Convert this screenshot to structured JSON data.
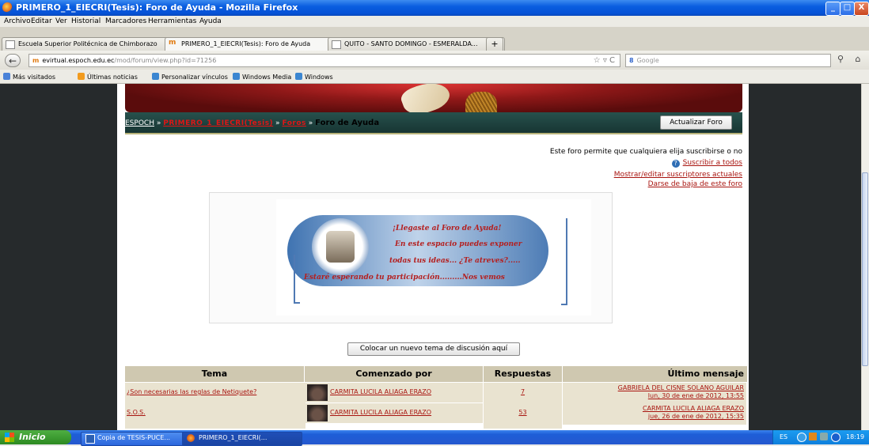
{
  "window": {
    "title": "PRIMERO_1_EIECRI(Tesis): Foro de Ayuda - Mozilla Firefox",
    "controls": {
      "minimize": "_",
      "maximize": "□",
      "close": "X"
    }
  },
  "menu": [
    "Archivo",
    "Editar",
    "Ver",
    "Historial",
    "Marcadores",
    "Herramientas",
    "Ayuda"
  ],
  "tabs": [
    {
      "label": "Escuela Superior Politécnica de Chimborazo",
      "active": false
    },
    {
      "label": "PRIMERO_1_EIECRI(Tesis): Foro de Ayuda",
      "active": true
    },
    {
      "label": "QUITO - SANTO DOMINGO - ESMERALDA...",
      "active": false
    }
  ],
  "tab_close": "×",
  "tab_new": "+",
  "nav": {
    "back": "←",
    "url_site": "m",
    "url_domain": "evirtual.espoch.edu.ec",
    "url_path": "/mod/forum/view.php?id=71256",
    "url_controls": "☆ ▿ C",
    "search_engine": "8",
    "search_placeholder": "Google",
    "search_icon": "⚲",
    "home_icon": "⌂"
  },
  "bookmarks": [
    "Más visitados",
    "Últimas noticias",
    "Personalizar vínculos",
    "Windows Media",
    "Windows"
  ],
  "forum": {
    "breadcrumb": {
      "home": "ESPOCH",
      "course": "PRIMERO_1_EIECRI(Tesis)",
      "forums": "Foros",
      "current": "Foro de Ayuda",
      "sep": "»"
    },
    "update_button": "Actualizar Foro",
    "subscription_note": "Este foro permite que cualquiera elija suscribirse o no",
    "help_icon": "?",
    "subscribe_all": "Suscribir a todos",
    "edit_subscribers": "Mostrar/editar suscriptores actuales",
    "unsubscribe": "Darse de baja de este foro",
    "welcome_lines": [
      "¡Llegaste al Foro de Ayuda!",
      "En este espacio puedes exponer",
      "todas tus ideas... ¿Te atreves?.....",
      "Estaré esperando tu participación.........Nos vemos"
    ],
    "new_topic_button": "Colocar un nuevo tema de discusión aquí",
    "table_headers": {
      "topic": "Tema",
      "started_by": "Comenzado por",
      "replies": "Respuestas",
      "last_post": "Último mensaje"
    },
    "rows": [
      {
        "topic": "¿Son necesarias las reglas de Netiquete?",
        "author": "CARMITA LUCILA ALIAGA ERAZO",
        "replies": "7",
        "last_author": "GABRIELA DEL CISNE SOLANO AGUILAR",
        "last_date": "lun, 30 de ene de 2012, 13:55"
      },
      {
        "topic": "S.O.S.",
        "author": "CARMITA LUCILA ALIAGA ERAZO",
        "replies": "53",
        "last_author": "CARMITA LUCILA ALIAGA ERAZO",
        "last_date": "jue, 26 de ene de 2012, 15:35"
      }
    ]
  },
  "taskbar": {
    "start": "Inicio",
    "tasks": [
      "Copia de TESIS-PUCE...",
      "PRIMERO_1_EIECRI(..."
    ],
    "lang": "ES",
    "clock": "18:19"
  }
}
